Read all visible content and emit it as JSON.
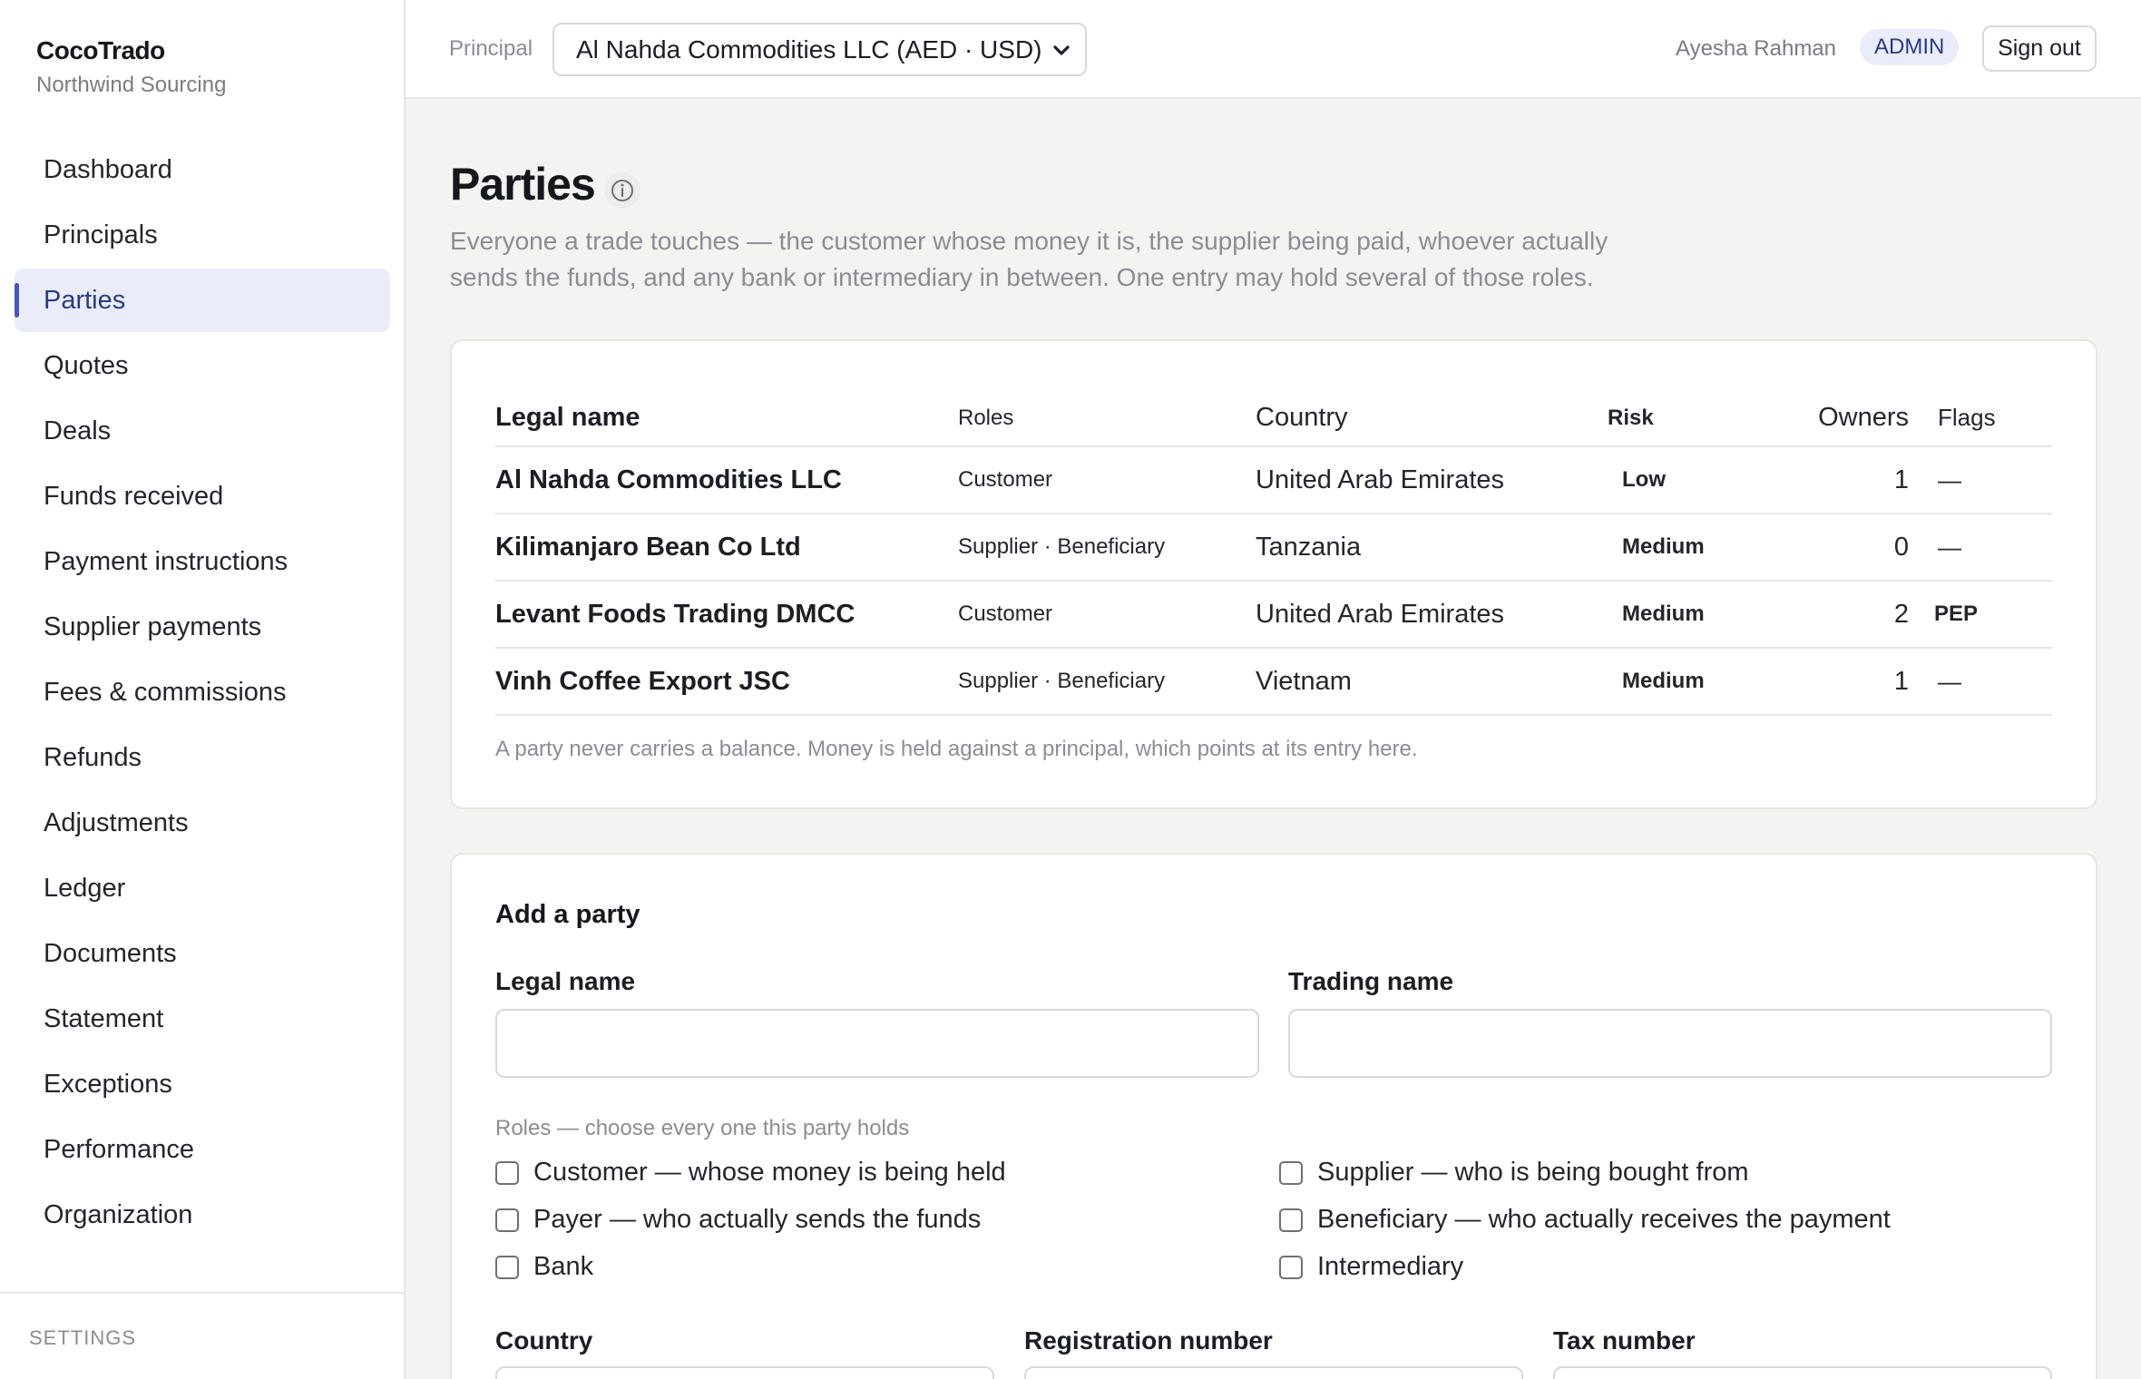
{
  "brand": {
    "name": "CocoTrado",
    "subtitle": "Northwind Sourcing"
  },
  "nav": {
    "items": [
      {
        "label": "Dashboard"
      },
      {
        "label": "Principals"
      },
      {
        "label": "Parties"
      },
      {
        "label": "Quotes"
      },
      {
        "label": "Deals"
      },
      {
        "label": "Funds received"
      },
      {
        "label": "Payment instructions"
      },
      {
        "label": "Supplier payments"
      },
      {
        "label": "Fees & commissions"
      },
      {
        "label": "Refunds"
      },
      {
        "label": "Adjustments"
      },
      {
        "label": "Ledger"
      },
      {
        "label": "Documents"
      },
      {
        "label": "Statement"
      },
      {
        "label": "Exceptions"
      },
      {
        "label": "Performance"
      },
      {
        "label": "Organization"
      }
    ],
    "active": "Parties",
    "settings_label": "SETTINGS"
  },
  "topbar": {
    "principal_label": "Principal",
    "principal_value": "Al Nahda Commodities LLC (AED · USD)",
    "user_name": "Ayesha Rahman",
    "role_badge": "ADMIN",
    "signout_label": "Sign out"
  },
  "page": {
    "title": "Parties",
    "description": "Everyone a trade touches — the customer whose money it is, the supplier being paid, whoever actually sends the funds, and any bank or intermediary in between. One entry may hold several of those roles."
  },
  "parties_table": {
    "headers": {
      "name": "Legal name",
      "roles": "Roles",
      "country": "Country",
      "risk": "Risk",
      "owners": "Owners",
      "flags": "Flags"
    },
    "rows": [
      {
        "name": "Al Nahda Commodities LLC",
        "roles": "Customer",
        "country": "United Arab Emirates",
        "risk": "Low",
        "owners": "1",
        "flags": "—"
      },
      {
        "name": "Kilimanjaro Bean Co Ltd",
        "roles": "Supplier · Beneficiary",
        "country": "Tanzania",
        "risk": "Medium",
        "owners": "0",
        "flags": "—"
      },
      {
        "name": "Levant Foods Trading DMCC",
        "roles": "Customer",
        "country": "United Arab Emirates",
        "risk": "Medium",
        "owners": "2",
        "flags": "PEP"
      },
      {
        "name": "Vinh Coffee Export JSC",
        "roles": "Supplier · Beneficiary",
        "country": "Vietnam",
        "risk": "Medium",
        "owners": "1",
        "flags": "—"
      }
    ],
    "note": "A party never carries a balance. Money is held against a principal, which points at its entry here."
  },
  "add_party": {
    "title": "Add a party",
    "legal_name_label": "Legal name",
    "legal_name_value": "",
    "trading_name_label": "Trading name",
    "trading_name_value": "",
    "roles_hint": "Roles — choose every one this party holds",
    "roles": {
      "customer": "Customer — whose money is being held",
      "supplier": "Supplier — who is being bought from",
      "payer": "Payer — who actually sends the funds",
      "beneficiary": "Beneficiary — who actually receives the payment",
      "bank": "Bank",
      "intermediary": "Intermediary"
    },
    "country_label": "Country",
    "registration_label": "Registration number",
    "tax_label": "Tax number"
  },
  "icons": {
    "info": "info-circle-icon",
    "select_arrow": "chevron-down-icon"
  },
  "colors": {
    "accent": "#4a56b8",
    "active_bg": "#eaedf9",
    "muted_text": "#8b8d93",
    "page_bg": "#f3f3f1"
  }
}
